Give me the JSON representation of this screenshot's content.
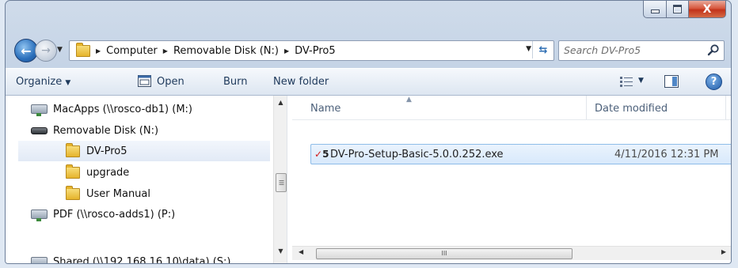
{
  "window": {
    "caption_buttons": {
      "minimize_icon": "minimize-icon",
      "maximize_icon": "maximize-icon",
      "close_label": "X"
    }
  },
  "navigation": {
    "back_icon": "back-arrow-icon",
    "forward_icon": "forward-arrow-icon",
    "breadcrumbs": [
      "Computer",
      "Removable Disk (N:)",
      "DV-Pro5"
    ],
    "search_placeholder": "Search DV-Pro5"
  },
  "toolbar": {
    "organize_label": "Organize",
    "open_label": "Open",
    "burn_label": "Burn",
    "new_folder_label": "New folder"
  },
  "nav_pane": {
    "items": [
      {
        "label": "MacApps (\\\\rosco-db1) (M:)",
        "icon": "network-drive-icon"
      },
      {
        "label": "Removable Disk (N:)",
        "icon": "removable-disk-icon"
      },
      {
        "label": "DV-Pro5",
        "icon": "folder-icon",
        "selected": true
      },
      {
        "label": "upgrade",
        "icon": "folder-icon"
      },
      {
        "label": "User Manual",
        "icon": "folder-icon"
      },
      {
        "label": "PDF (\\\\rosco-adds1) (P:)",
        "icon": "network-drive-icon"
      },
      {
        "label": "Shared (\\\\192.168.16.10\\data) (S:)",
        "icon": "network-drive-icon"
      }
    ]
  },
  "file_list": {
    "columns": [
      "Name",
      "Date modified"
    ],
    "files": [
      {
        "name": "DV-Pro-Setup-Basic-5.0.0.252.exe",
        "date_modified": "4/11/2016 12:31 PM",
        "icon": "installer-icon",
        "icon_text": "5"
      }
    ]
  },
  "scrollbars": {
    "thumb_grip": "III"
  }
}
